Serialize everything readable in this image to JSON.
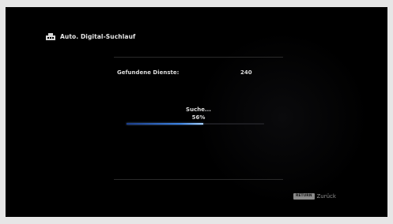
{
  "header": {
    "icon": "antenna-search-icon",
    "title": "Auto. Digital-Suchlauf"
  },
  "scan": {
    "found_label": "Gefundene Dienste:",
    "found_value": "240",
    "status": "Suche...",
    "percent_text": "56%",
    "progress": 0.56
  },
  "footer": {
    "return_badge": "RETURN",
    "return_label": "Zurück"
  },
  "colors": {
    "background": "#000000",
    "progress_accent": "#3e86e6"
  }
}
